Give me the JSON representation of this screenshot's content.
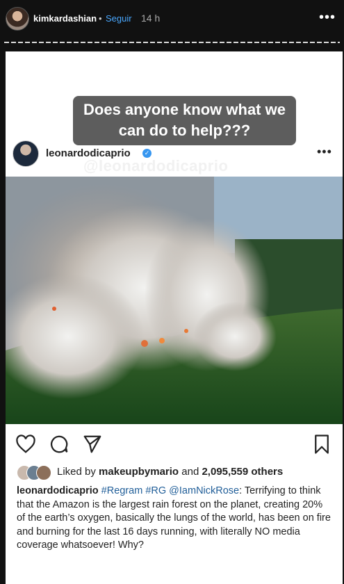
{
  "story": {
    "username": "kimkardashian",
    "separator": "•",
    "follow_label": "Seguir",
    "time_ago": "14 h",
    "more_icon": "ellipsis-icon"
  },
  "overlay": {
    "question": "Does anyone know what we can do to help???"
  },
  "post": {
    "username": "leonardodicaprio",
    "watermark": "@leonardodicaprio",
    "liked_prefix": "Liked by",
    "liked_user": "makeupbymario",
    "liked_and": "and",
    "liked_count": "2,095,559 others",
    "caption_user": "leonardodicaprio",
    "caption_tags": "#Regram #RG @IamNickRose",
    "caption_text": ": Terrifying to think that the Amazon is the largest rain forest on the planet, creating 20% of the earth’s oxygen, basically the lungs of the world, has been on fire and burning for the last 16 days running, with literally NO media coverage whatsoever! Why?",
    "icons": [
      "heart-icon",
      "comment-icon",
      "share-icon",
      "bookmark-icon"
    ]
  },
  "colors": {
    "follow": "#4aa8ff",
    "verified": "#3897f0",
    "tag": "#1f5d98",
    "bubble": "#5d5d5d"
  }
}
